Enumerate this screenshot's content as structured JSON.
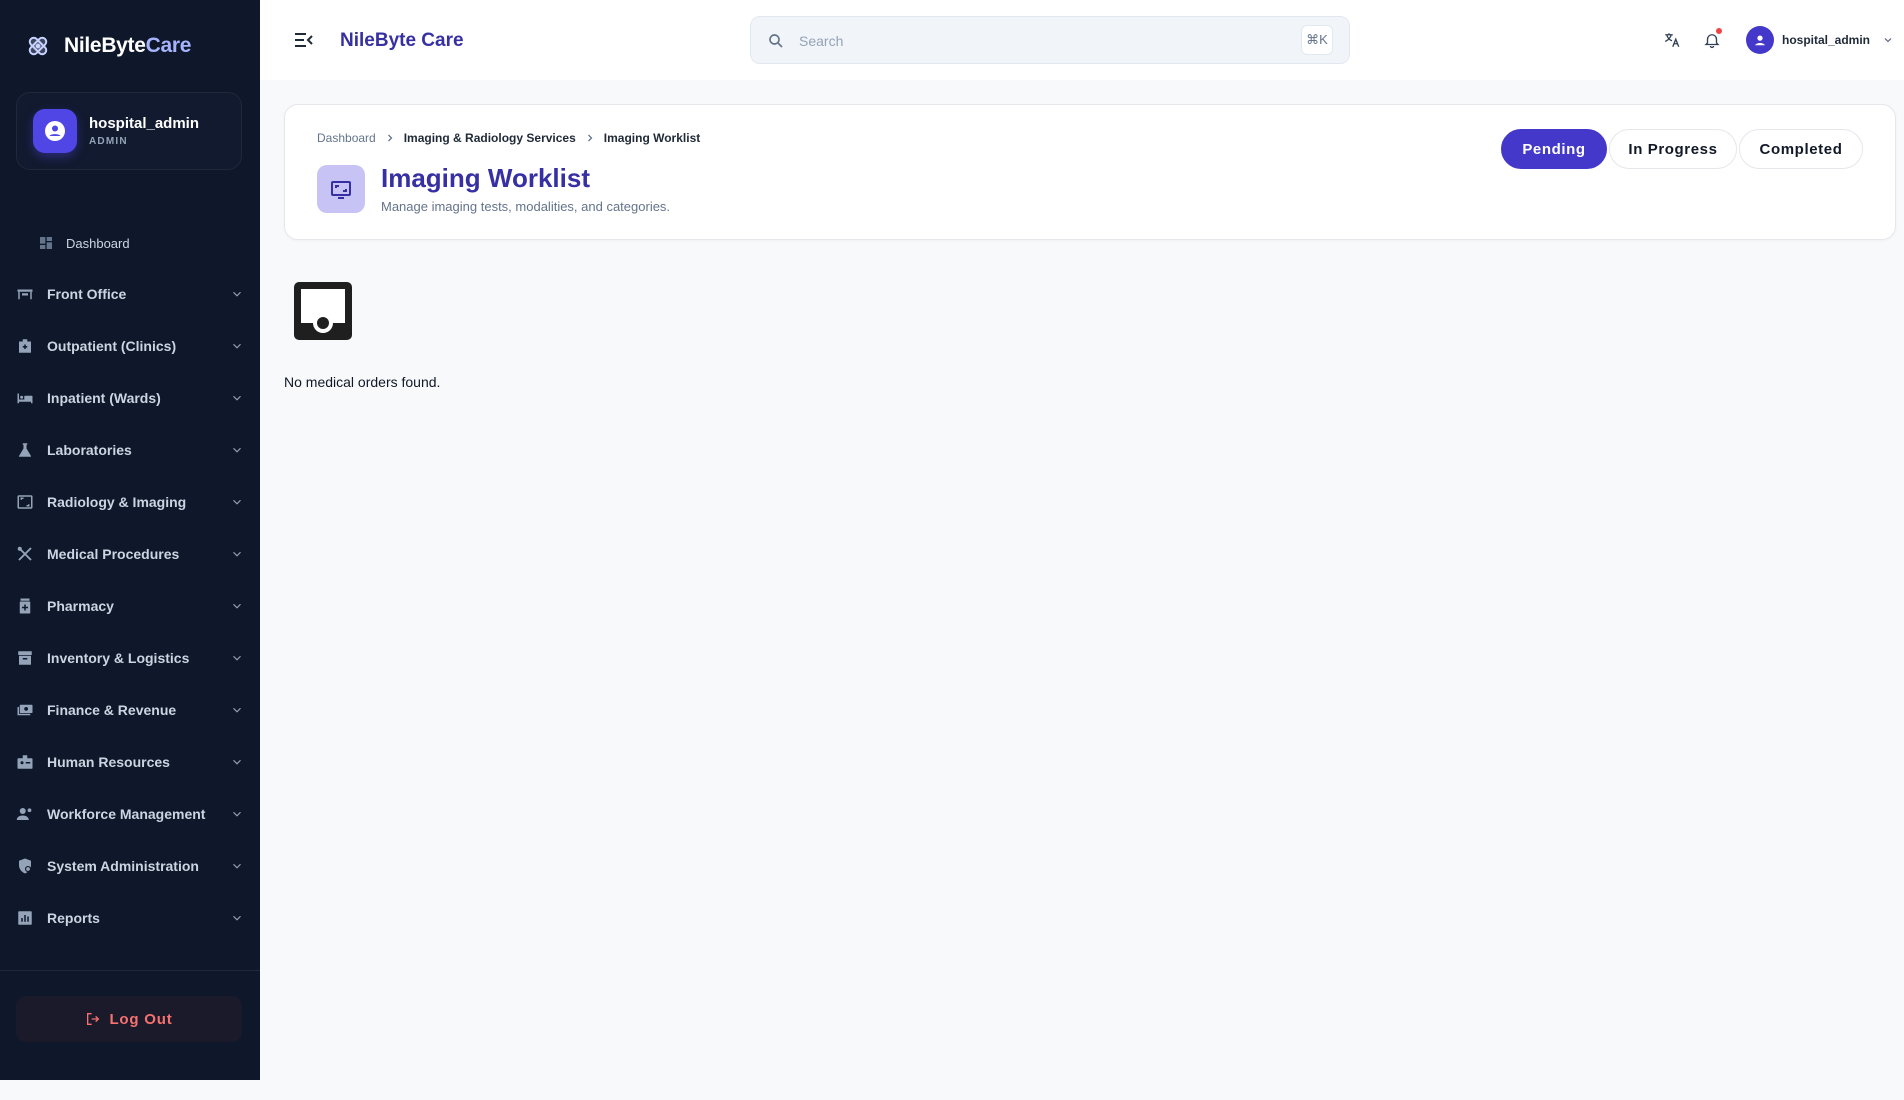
{
  "brand": {
    "name_part1": "NileByte",
    "name_part2": "Care"
  },
  "user": {
    "name": "hospital_admin",
    "role": "ADMIN"
  },
  "sidebar": {
    "dashboard_label": "Dashboard",
    "items": [
      {
        "label": "Front Office",
        "icon": "reception-icon"
      },
      {
        "label": "Outpatient (Clinics)",
        "icon": "medical-bag-icon"
      },
      {
        "label": "Inpatient (Wards)",
        "icon": "bed-icon"
      },
      {
        "label": "Laboratories",
        "icon": "flask-icon"
      },
      {
        "label": "Radiology & Imaging",
        "icon": "scan-icon"
      },
      {
        "label": "Medical Procedures",
        "icon": "tools-icon"
      },
      {
        "label": "Pharmacy",
        "icon": "pill-bottle-icon"
      },
      {
        "label": "Inventory & Logistics",
        "icon": "archive-icon"
      },
      {
        "label": "Finance & Revenue",
        "icon": "money-icon"
      },
      {
        "label": "Human Resources",
        "icon": "badge-icon"
      },
      {
        "label": "Workforce Management",
        "icon": "people-icon"
      },
      {
        "label": "System Administration",
        "icon": "shield-gear-icon"
      },
      {
        "label": "Reports",
        "icon": "chart-icon"
      }
    ],
    "logout_label": "Log Out"
  },
  "topbar": {
    "title": "NileByte Care",
    "search_placeholder": "Search",
    "shortcut": "⌘K",
    "profile_name": "hospital_admin"
  },
  "page": {
    "breadcrumb": [
      "Dashboard",
      "Imaging & Radiology Services",
      "Imaging Worklist"
    ],
    "title": "Imaging Worklist",
    "subtitle": "Manage imaging tests, modalities, and categories.",
    "tabs": [
      {
        "label": "Pending",
        "active": true
      },
      {
        "label": "In Progress",
        "active": false
      },
      {
        "label": "Completed",
        "active": false
      }
    ],
    "empty_message": "No medical orders found."
  },
  "colors": {
    "sidebar_bg": "#0f172a",
    "accent": "#4338ca",
    "danger": "#f87171"
  }
}
